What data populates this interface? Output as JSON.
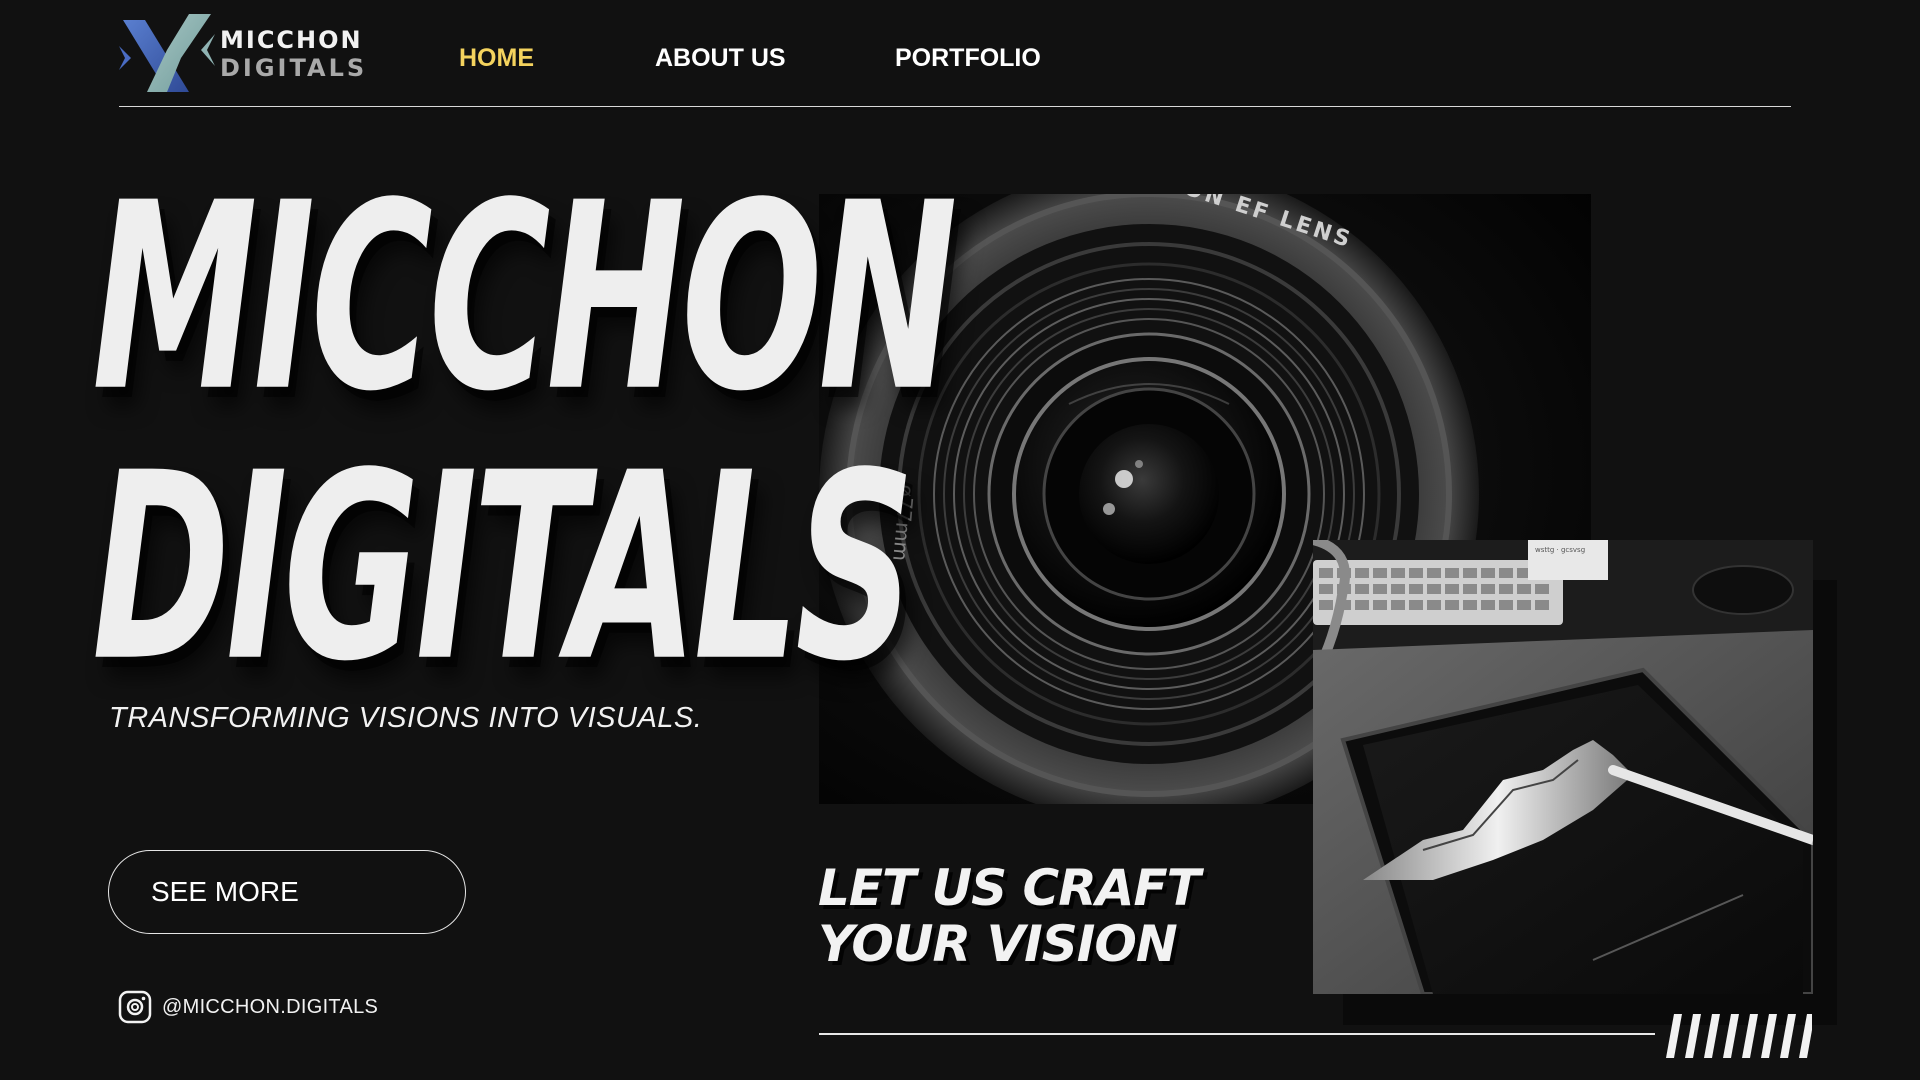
{
  "brand": {
    "line1": "MICCHON",
    "line2": "DIGITALS",
    "colors": {
      "mark_teal": "#8fb3b3",
      "mark_blue": "#3b5aa6",
      "text_light": "#f2f2f2",
      "text_gray": "#a9a9a9"
    }
  },
  "nav": {
    "items": [
      {
        "label": "HOME",
        "active": true
      },
      {
        "label": "ABOUT US",
        "active": false
      },
      {
        "label": "PORTFOLIO",
        "active": false
      }
    ],
    "active_color": "#f4d35e"
  },
  "hero": {
    "title_line1": "MICCHON",
    "title_line2": "DIGITALS",
    "tagline": "TRANSFORMING VISIONS INTO VISUALS."
  },
  "lens_text": {
    "ring_text": "ON EF LENS",
    "side_text": "ø77mm"
  },
  "tablet_photo": {
    "note_text": "wsttg · gcsvsg"
  },
  "cta": {
    "button_label": "SEE MORE",
    "headline_line1": "LET US CRAFT",
    "headline_line2": "YOUR VISION"
  },
  "social": {
    "icon": "instagram-icon",
    "handle": "@MICCHON.DIGITALS"
  },
  "theme": {
    "background": "#111111",
    "text": "#f2f2f2"
  }
}
